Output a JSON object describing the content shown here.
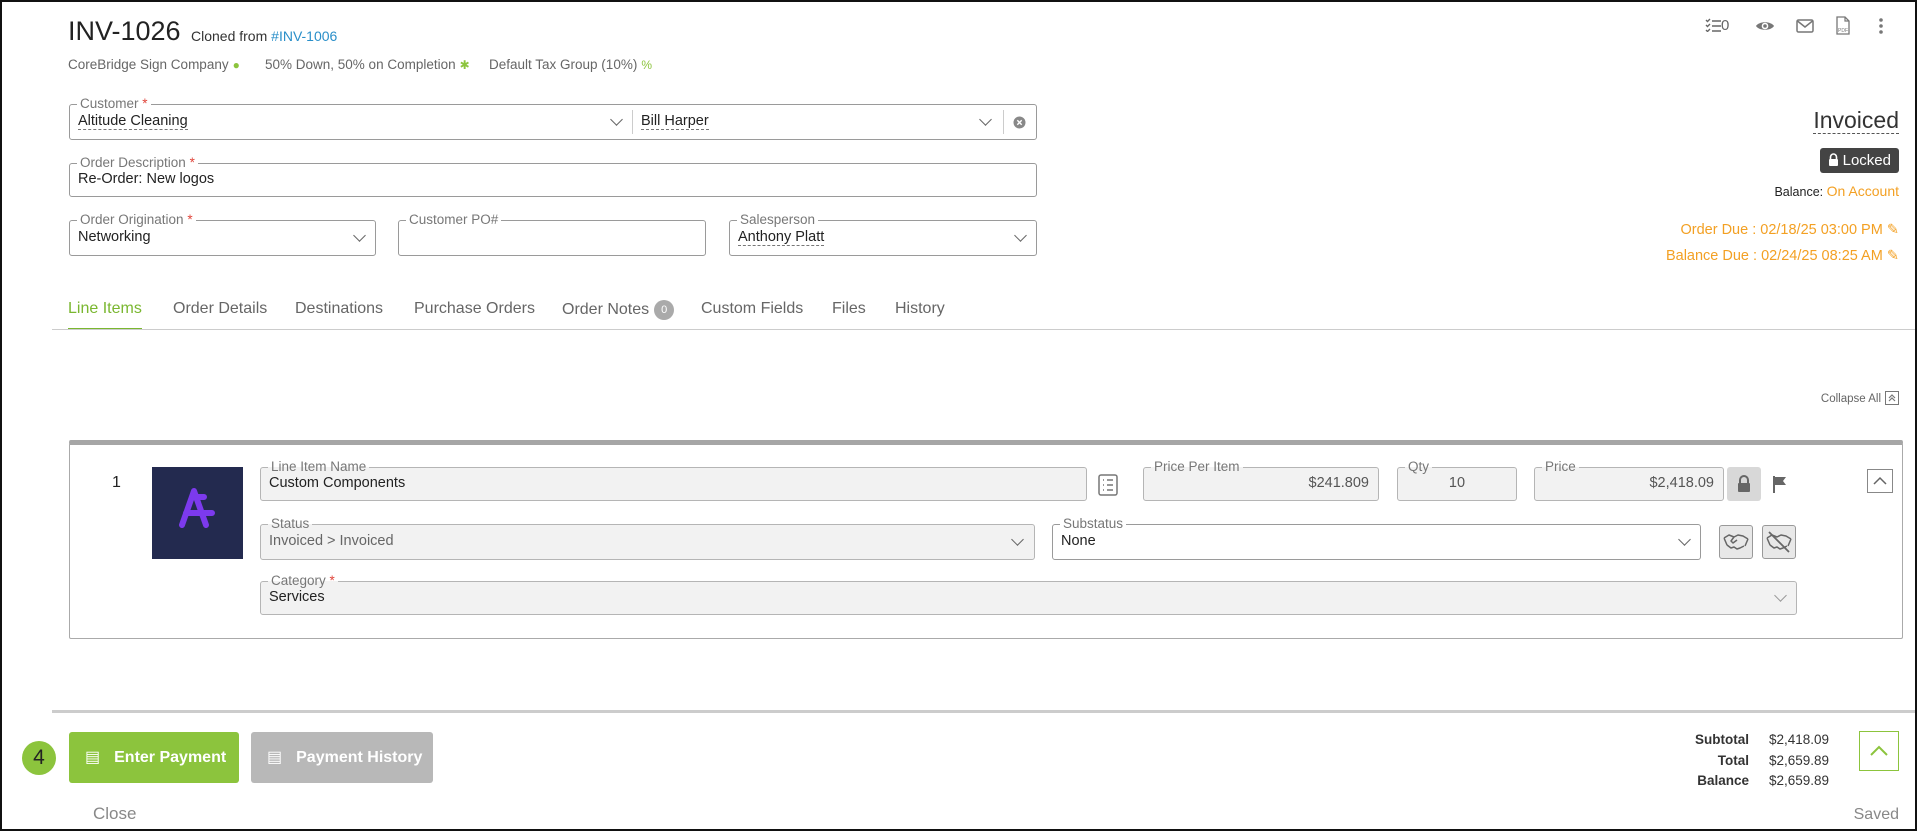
{
  "header": {
    "title": "INV-1026",
    "cloned_prefix": "Cloned from",
    "cloned_link": "#INV-1006",
    "company": "CoreBridge Sign Company",
    "terms": "50% Down, 50% on Completion",
    "tax_group": "Default Tax Group (10%)",
    "checklist_count": "0"
  },
  "form": {
    "customer_label": "Customer",
    "customer_value": "Altitude Cleaning",
    "contact_value": "Bill Harper",
    "description_label": "Order Description",
    "description_value": "Re-Order: New logos",
    "origination_label": "Order Origination",
    "origination_value": "Networking",
    "po_label": "Customer PO#",
    "po_value": "",
    "salesperson_label": "Salesperson",
    "salesperson_value": "Anthony Platt"
  },
  "status": {
    "state": "Invoiced",
    "locked_label": "Locked",
    "balance_label": "Balance:",
    "balance_value": "On Account",
    "order_due": "Order Due : 02/18/25 03:00 PM",
    "balance_due": "Balance Due : 02/24/25 08:25 AM"
  },
  "tabs": [
    {
      "label": "Line Items"
    },
    {
      "label": "Order Details"
    },
    {
      "label": "Destinations"
    },
    {
      "label": "Purchase Orders"
    },
    {
      "label": "Order Notes",
      "badge": "0"
    },
    {
      "label": "Custom Fields"
    },
    {
      "label": "Files"
    },
    {
      "label": "History"
    }
  ],
  "collapse_all": "Collapse All",
  "line_item": {
    "number": "1",
    "name_label": "Line Item Name",
    "name_value": "Custom Components",
    "price_per_item_label": "Price Per Item",
    "price_per_item_value": "$241.809",
    "qty_label": "Qty",
    "qty_value": "10",
    "price_label": "Price",
    "price_value": "$2,418.09",
    "status_label": "Status",
    "status_value": "Invoiced > Invoiced",
    "substatus_label": "Substatus",
    "substatus_value": "None",
    "category_label": "Category",
    "category_value": "Services"
  },
  "footer": {
    "step": "4",
    "enter_payment": "Enter Payment",
    "payment_history": "Payment History",
    "close": "Close",
    "saved": "Saved",
    "subtotal_label": "Subtotal",
    "subtotal_value": "$2,418.09",
    "total_label": "Total",
    "total_value": "$2,659.89",
    "balance_label": "Balance",
    "balance_value": "$2,659.89"
  },
  "colors": {
    "accent": "#8cc43d",
    "link": "#2a8fc9",
    "warning": "#f3a023",
    "required": "#e0453b"
  }
}
